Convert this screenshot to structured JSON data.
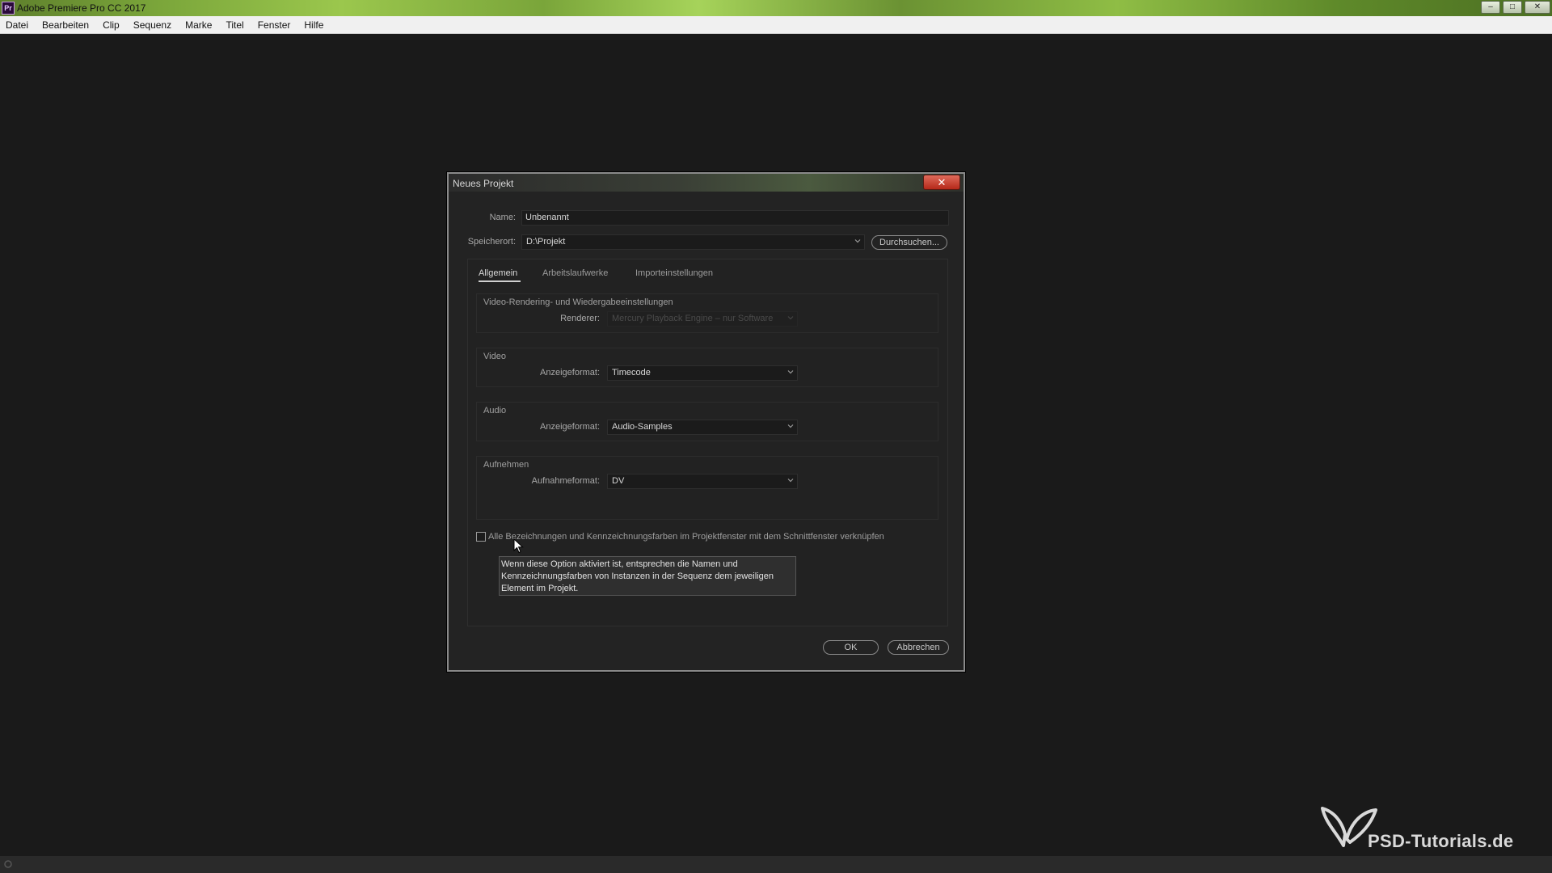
{
  "app": {
    "title": "Adobe Premiere Pro CC 2017",
    "logo_text": "Pr",
    "logo_color": "#c59be0"
  },
  "window_controls": {
    "minimize": "–",
    "maximize": "□",
    "close": "✕"
  },
  "menu": [
    "Datei",
    "Bearbeiten",
    "Clip",
    "Sequenz",
    "Marke",
    "Titel",
    "Fenster",
    "Hilfe"
  ],
  "dialog": {
    "title": "Neues Projekt",
    "close_label": "✕",
    "name_label": "Name:",
    "name_value": "Unbenannt",
    "location_label": "Speicherort:",
    "location_value": "D:\\Projekt",
    "browse_label": "Durchsuchen...",
    "tabs": [
      "Allgemein",
      "Arbeitslaufwerke",
      "Importeinstellungen"
    ],
    "active_tab": "Allgemein",
    "groups": {
      "rendering": {
        "title": "Video-Rendering- und Wiedergabeeinstellungen",
        "renderer_label": "Renderer:",
        "renderer_value": "Mercury Playback Engine – nur Software"
      },
      "video": {
        "title": "Video",
        "format_label": "Anzeigeformat:",
        "format_value": "Timecode"
      },
      "audio": {
        "title": "Audio",
        "format_label": "Anzeigeformat:",
        "format_value": "Audio-Samples"
      },
      "capture": {
        "title": "Aufnehmen",
        "format_label": "Aufnahmeformat:",
        "format_value": "DV"
      }
    },
    "link_checkbox_label": "Alle Bezeichnungen und Kennzeichnungsfarben im Projektfenster mit dem Schnittfenster verknüpfen",
    "link_checkbox_checked": false,
    "tooltip_lines": [
      "Wenn diese Option aktiviert ist, entsprechen die Namen und",
      "Kennzeichnungsfarben von Instanzen in der Sequenz dem jeweiligen",
      "Element im Projekt."
    ],
    "ok_label": "OK",
    "cancel_label": "Abbrechen"
  },
  "watermark": {
    "text": "PSD-Tutorials.de"
  },
  "colors": {
    "titlebar_green": "#7aa53a",
    "background": "#1a1a1a",
    "dialog_bg": "#232323"
  }
}
